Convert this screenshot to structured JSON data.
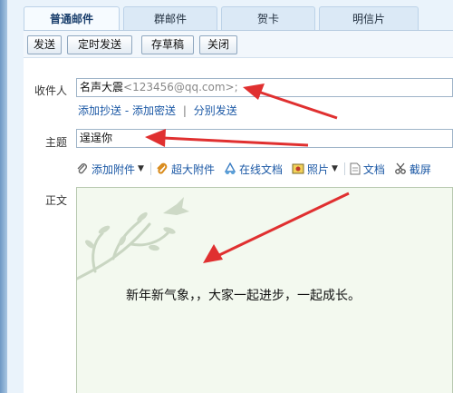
{
  "tabs": [
    {
      "label": "普通邮件",
      "active": true
    },
    {
      "label": "群邮件",
      "active": false
    },
    {
      "label": "贺卡",
      "active": false
    },
    {
      "label": "明信片",
      "active": false
    }
  ],
  "toolbar": {
    "send": "发送",
    "scheduled_send": "定时发送",
    "save_draft": "存草稿",
    "close": "关闭"
  },
  "recipients": {
    "label": "收件人",
    "name": "名声大震",
    "address": "<123456@qq.com>;"
  },
  "recipient_links": {
    "add_cc": "添加抄送",
    "dash": "-",
    "add_bcc": "添加密送",
    "separator": "|",
    "separate_send": "分别发送"
  },
  "subject": {
    "label": "主题",
    "value": "逞逞你"
  },
  "attachments": {
    "add_attachment": "添加附件",
    "large_attachment": "超大附件",
    "online_doc": "在线文档",
    "photo": "照片",
    "document": "文档",
    "screenshot": "截屏"
  },
  "body": {
    "label": "正文",
    "text": "新年新气象，，大家一起进步，一起成长。"
  },
  "colors": {
    "arrow": "#e03030",
    "link": "#1b58a5",
    "editor_bg": "#f3f9ef"
  }
}
